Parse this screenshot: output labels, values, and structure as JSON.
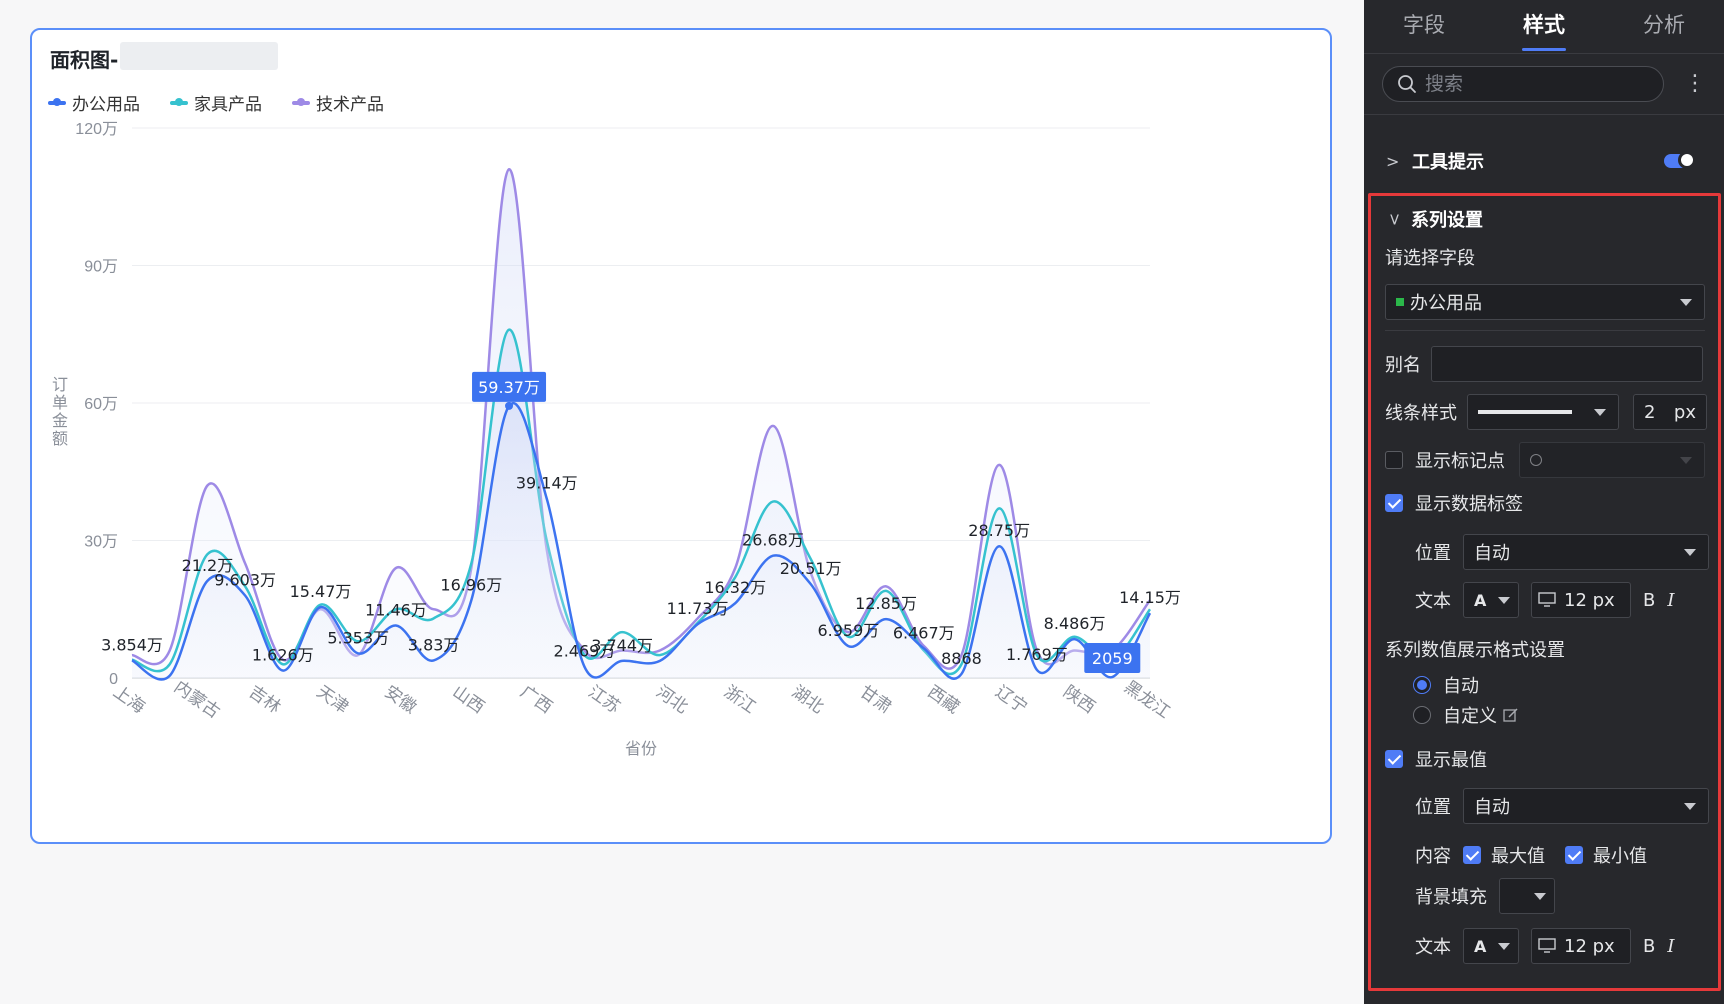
{
  "chart": {
    "title": "面积图-",
    "legend": [
      {
        "name": "办公用品",
        "color": "#3c73f0"
      },
      {
        "name": "家具产品",
        "color": "#36c2cf"
      },
      {
        "name": "技术产品",
        "color": "#9e8ae6"
      }
    ],
    "highlight_label": "59.37万",
    "min_label": "2059"
  },
  "chart_data": {
    "type": "area",
    "xlabel": "省份",
    "ylabel": "订单金额",
    "ylim": [
      0,
      1200000
    ],
    "y_ticks": [
      "0",
      "30万",
      "60万",
      "90万",
      "120万"
    ],
    "categories": [
      "上海",
      "内蒙古",
      "吉林",
      "天津",
      "安徽",
      "山西",
      "广西",
      "江苏",
      "河北",
      "浙江",
      "湖北",
      "甘肃",
      "西藏",
      "辽宁",
      "陕西",
      "黑龙江"
    ],
    "x_tick_every": 1,
    "series": [
      {
        "name": "办公用品",
        "color": "#3c73f0",
        "values": [
          38540,
          5000,
          212000,
          180000,
          16260,
          154700,
          53530,
          114600,
          38300,
          169600,
          593700,
          391400,
          24690,
          37440,
          37440,
          117300,
          163200,
          266800,
          205100,
          69590,
          128500,
          64670,
          8868,
          287500,
          17690,
          84860,
          2059,
          141500
        ],
        "labels": [
          "3.854万",
          "",
          "21.2万",
          "9.603万",
          "1.626万",
          "15.47万",
          "5.353万",
          "11.46万",
          "3.83万",
          "16.96万",
          "",
          "39.14万",
          "2.469万",
          "3.744万",
          "",
          "11.73万",
          "16.32万",
          "26.68万",
          "20.51万",
          "6.959万",
          "12.85万",
          "6.467万",
          "8868",
          "28.75万",
          "1.769万",
          "8.486万",
          "",
          "14.15万"
        ]
      },
      {
        "name": "家具产品",
        "color": "#36c2cf",
        "values": [
          40000,
          30000,
          270000,
          200000,
          30000,
          160000,
          80000,
          150000,
          130000,
          250000,
          760000,
          300000,
          50000,
          100000,
          50000,
          120000,
          220000,
          385000,
          260000,
          90000,
          190000,
          60000,
          30000,
          370000,
          50000,
          90000,
          40000,
          150000
        ]
      },
      {
        "name": "技术产品",
        "color": "#9e8ae6",
        "values": [
          50000,
          60000,
          420000,
          250000,
          40000,
          150000,
          50000,
          240000,
          150000,
          240000,
          1110000,
          280000,
          60000,
          60000,
          60000,
          130000,
          240000,
          550000,
          230000,
          100000,
          200000,
          70000,
          50000,
          465000,
          60000,
          60000,
          60000,
          170000
        ]
      }
    ]
  },
  "panel": {
    "tabs": [
      "字段",
      "样式",
      "分析"
    ],
    "search_placeholder": "搜索",
    "tooltip_section": "工具提示",
    "series_section": "系列设置",
    "choose_field": "请选择字段",
    "selected_field": "办公用品",
    "alias_label": "别名",
    "line_style_label": "线条样式",
    "line_width": "2",
    "px": "px",
    "show_marker": "显示标记点",
    "show_data_label": "显示数据标签",
    "position_label": "位置",
    "position_value": "自动",
    "text_label": "文本",
    "font_letter": "A",
    "font_size": "12 px",
    "bold": "B",
    "italic": "I",
    "format_section": "系列数值展示格式设置",
    "format_auto": "自动",
    "format_custom": "自定义",
    "show_extreme": "显示最值",
    "content_label": "内容",
    "max_label": "最大值",
    "min_label": "最小值",
    "bg_fill_label": "背景填充"
  }
}
